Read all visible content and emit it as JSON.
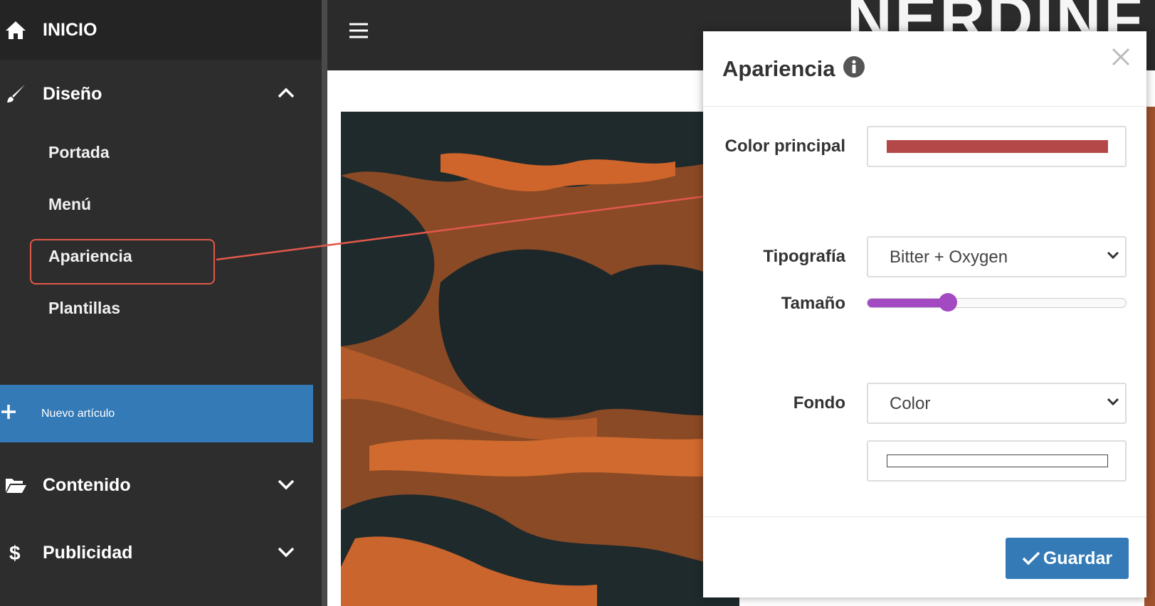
{
  "sidebar": {
    "home": {
      "label": "INICIO",
      "icon": "home-icon"
    },
    "diseno": {
      "label": "Diseño",
      "icon": "paintbrush-icon",
      "items": [
        {
          "label": "Portada"
        },
        {
          "label": "Menú"
        },
        {
          "label": "Apariencia"
        },
        {
          "label": "Plantillas"
        }
      ]
    },
    "new_article": {
      "label": "Nuevo artículo",
      "icon": "plus-icon"
    },
    "contenido": {
      "label": "Contenido",
      "icon": "folder-open-icon"
    },
    "publicidad": {
      "label": "Publicidad",
      "icon": "dollar-icon"
    }
  },
  "header": {
    "brand": "NERDINF"
  },
  "modal": {
    "title": "Apariencia",
    "fields": {
      "color_principal": {
        "label": "Color principal",
        "value": "#b44848"
      },
      "tipografia": {
        "label": "Tipografía",
        "value": "Bitter + Oxygen"
      },
      "tamano": {
        "label": "Tamaño",
        "value": 0.31
      },
      "fondo": {
        "label": "Fondo",
        "value": "Color",
        "color": "#ffffff"
      }
    },
    "save_label": "Guardar"
  },
  "colors": {
    "accent": "#337ab7",
    "highlight": "#e2584a",
    "slider": "#a349c2",
    "sidebar": "#2d2d2d"
  }
}
